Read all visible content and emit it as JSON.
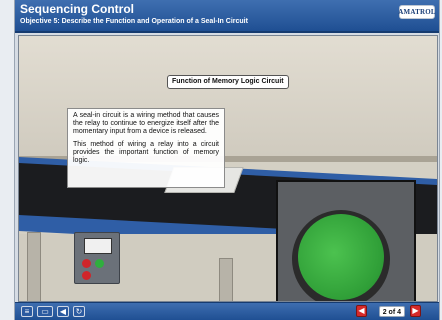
{
  "header": {
    "title": "Sequencing Control",
    "objective": "Objective 5: Describe the Function and Operation of a Seal-In Circuit",
    "logo": "AMATROL"
  },
  "scene": {
    "caption": "Function of Memory Logic Circuit",
    "paragraphs": [
      "A seal-in circuit is a wiring method that causes the relay to continue to energize itself after the momentary input from a device is released.",
      "This method of wiring a relay into a circuit provides the important function of memory logic."
    ],
    "zoom_subject": "green pushbutton"
  },
  "footer": {
    "icons": [
      "menu-icon",
      "glossary-icon",
      "audio-icon",
      "replay-icon"
    ],
    "pager": "2 of 4",
    "prev_icon": "◀",
    "next_icon": "▶"
  },
  "colors": {
    "header_blue": "#2a5ba3",
    "button_green": "#2f9e37",
    "nav_red": "#d62a2a"
  }
}
